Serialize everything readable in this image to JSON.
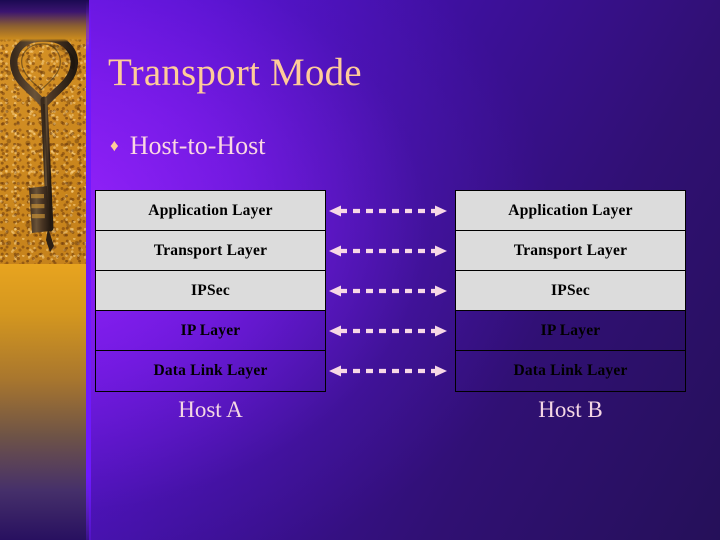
{
  "slide": {
    "title": "Transport Mode",
    "bullet_glyph": "♦",
    "bullet_text": "Host-to-Host",
    "title_color": "#ffcc99",
    "bullet_color": "#fbd7e2",
    "background_color": "#4e11c6",
    "sidebar_image": "old-key-on-sand-photo"
  },
  "diagram": {
    "arrow_color": "#f7d8e6",
    "cell_fill": "#dcdcdc",
    "cell_border": "#000000",
    "layers": [
      {
        "label": "Application Layer",
        "filled": true
      },
      {
        "label": "Transport Layer",
        "filled": true
      },
      {
        "label": "IPSec",
        "filled": true
      },
      {
        "label": "IP Layer",
        "filled": false
      },
      {
        "label": "Data Link Layer",
        "filled": false
      }
    ],
    "host_a": {
      "caption": "Host A",
      "layers": [
        "Application Layer",
        "Transport Layer",
        "IPSec",
        "IP Layer",
        "Data Link Layer"
      ]
    },
    "host_b": {
      "caption": "Host B",
      "layers": [
        "Application Layer",
        "Transport Layer",
        "IPSec",
        "IP Layer",
        "Data Link Layer"
      ]
    },
    "connections": [
      {
        "from": "Application Layer",
        "to": "Application Layer",
        "style": "dashed",
        "heads": "both"
      },
      {
        "from": "Transport Layer",
        "to": "Transport Layer",
        "style": "dashed",
        "heads": "both"
      },
      {
        "from": "IPSec",
        "to": "IPSec",
        "style": "dashed",
        "heads": "both"
      },
      {
        "from": "IP Layer",
        "to": "IP Layer",
        "style": "dashed",
        "heads": "both"
      },
      {
        "from": "Data Link Layer",
        "to": "Data Link Layer",
        "style": "dashed",
        "heads": "both"
      }
    ]
  }
}
